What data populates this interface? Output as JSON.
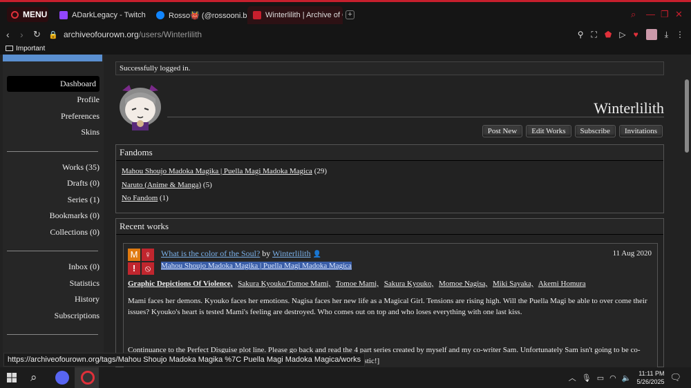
{
  "browser": {
    "menu_label": "MENU",
    "tabs": [
      {
        "label": "ADarkLegacy - Twitch",
        "color": "#9146ff"
      },
      {
        "label": "Rosso👹 (@rossooni.bsky",
        "color": "#1185fe"
      },
      {
        "label": "Winterlilith | Archive of Ou",
        "color": "#c71f2d"
      }
    ],
    "url_main": "archiveofourown.org",
    "url_path": "/users/Winterlilith",
    "bookmark": "Important"
  },
  "sidebar": {
    "group1": [
      "Dashboard",
      "Profile",
      "Preferences",
      "Skins"
    ],
    "group2": [
      "Works (35)",
      "Drafts (0)",
      "Series (1)",
      "Bookmarks (0)",
      "Collections (0)"
    ],
    "group3": [
      "Inbox (0)",
      "Statistics",
      "History",
      "Subscriptions"
    ]
  },
  "flash": "Successfully logged in.",
  "username": "Winterlilith",
  "actions": [
    "Post New",
    "Edit Works",
    "Subscribe",
    "Invitations"
  ],
  "fandoms": {
    "heading": "Fandoms",
    "items": [
      {
        "name": "Mahou Shoujo Madoka Magika | Puella Magi Madoka Magica",
        "count": "(29)"
      },
      {
        "name": "Naruto (Anime & Manga)",
        "count": "(5)"
      },
      {
        "name": "No Fandom",
        "count": "(1)"
      }
    ]
  },
  "recent": {
    "heading": "Recent works",
    "work": {
      "title": "What is the color of the Soul?",
      "by": "by",
      "author": "Winterlilith",
      "date": "11 Aug 2020",
      "fandom": "Mahou Shoujo Madoka Magika | Puella Magi Madoka Magica",
      "warning": "Graphic Depictions Of Violence,",
      "tags": [
        "Sakura Kyouko/Tomoe Mami,",
        "Tomoe Mami,",
        "Sakura Kyouko,",
        "Momoe Nagisa,",
        "Miki Sayaka,",
        "Akemi Homura"
      ],
      "summary": "Mami faces her demons. Kyouko faces her emotions. Nagisa faces her new life as a Magical Girl. Tensions are rising high. Will the Puella Magi be able to over come their issues? Kyouko's heart is tested Mami's feeling are destroyed. Who comes out on top and who loses everything with one last kiss.",
      "note": "Continuance to the Perfect Disguise plot line. Please go back and read the 4 part series created by myself and my co-writer Sam. Unfortunately Sam isn't going to be co-writing this one with Ill be continuing this storyline by myself with... be fantastic!]",
      "symbols": {
        "rating": "M",
        "gender": "♀",
        "warn": "!",
        "complete": "⦸"
      }
    }
  },
  "status_url": "https://archiveofourown.org/tags/Mahou Shoujo Madoka Magika %7C Puella Magi Madoka Magica/works",
  "taskbar": {
    "time": "11:11 PM",
    "date": "5/26/2025"
  },
  "colors": {
    "accent": "#c71f2d",
    "link": "#7ab0e8",
    "highlight": "#3a5ea8"
  }
}
